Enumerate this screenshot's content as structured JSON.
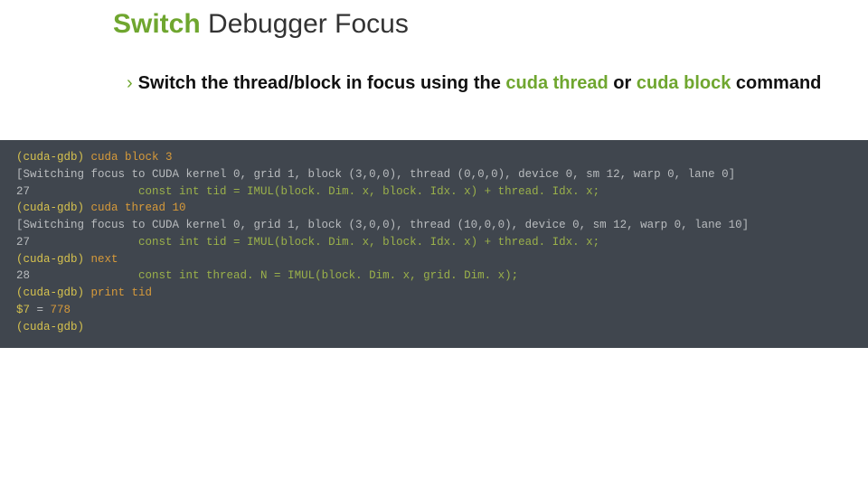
{
  "title": {
    "highlight": "Switch",
    "rest": " Debugger Focus"
  },
  "bullet": {
    "chevron": "›",
    "pre": "Switch the thread/block in focus using the ",
    "cmd1": "cuda thread",
    "mid": " or ",
    "cmd2": "cuda block",
    "post": " command"
  },
  "code": {
    "l01p": "(cuda-gdb) ",
    "l01c": "cuda block 3",
    "l02": "[Switching focus to CUDA kernel 0, grid 1, block (3,0,0), thread (0,0,0), device 0, sm 12, warp 0, lane 0]",
    "l03n": "27",
    "l03s": "                const int tid = IMUL(block. Dim. x, block. Idx. x) + thread. Idx. x;",
    "l04p": "(cuda-gdb) ",
    "l04c": "cuda thread 10",
    "l05": "[Switching focus to CUDA kernel 0, grid 1, block (3,0,0), thread (10,0,0), device 0, sm 12, warp 0, lane 10]",
    "l06n": "27",
    "l06s": "                const int tid = IMUL(block. Dim. x, block. Idx. x) + thread. Idx. x;",
    "l07p": "(cuda-gdb) ",
    "l07c": "next",
    "l08n": "28",
    "l08s": "                const int thread. N = IMUL(block. Dim. x, grid. Dim. x);",
    "l09p": "(cuda-gdb) ",
    "l09c": "print tid",
    "l10v": "$7",
    "l10eq": " = ",
    "l10r": "778",
    "l11p": "(cuda-gdb)"
  }
}
